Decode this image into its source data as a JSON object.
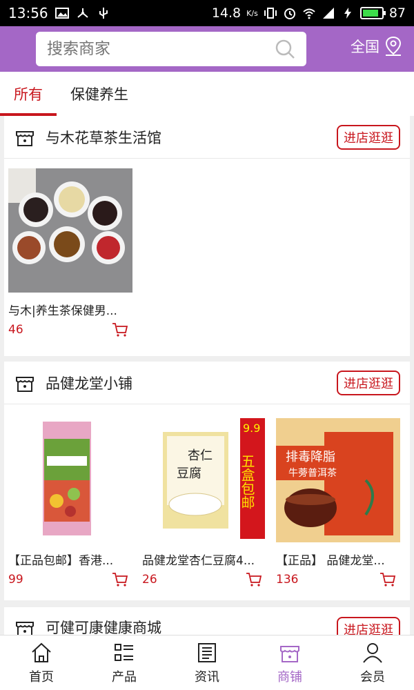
{
  "status": {
    "time": "13:56",
    "speed": "14.8",
    "speed_unit": "K/s",
    "battery": "87",
    "battery_fill": 0.87
  },
  "header": {
    "search_placeholder": "搜索商家",
    "region": "全国"
  },
  "tabs": [
    {
      "label": "所有",
      "active": true
    },
    {
      "label": "保健养生",
      "active": false
    }
  ],
  "shops": [
    {
      "name": "与木花草茶生活馆",
      "visit_label": "进店逛逛",
      "products": [
        {
          "name": "与木|养生茶保健男...",
          "price": "46"
        }
      ]
    },
    {
      "name": "品健龙堂小铺",
      "visit_label": "进店逛逛",
      "products": [
        {
          "name": "【正品包邮】香港...",
          "price": "99"
        },
        {
          "name": "品健龙堂杏仁豆腐4...",
          "price": "26"
        },
        {
          "name": "【正品】 品健龙堂...",
          "price": "136"
        }
      ]
    },
    {
      "name": "可健可康健康商城",
      "visit_label": "进店逛逛",
      "products": []
    }
  ],
  "product_art": {
    "almond_tofu": {
      "top": "杏仁",
      "bottom": "豆腐",
      "badge": "9.9",
      "promo": "五盒包邮"
    },
    "puer_tea": {
      "title": "排毒降脂",
      "subtitle": "牛蒡普洱茶"
    }
  },
  "colors": {
    "brand": "#a467c6",
    "accent": "#c8161d"
  },
  "bottom_nav": [
    {
      "label": "首页",
      "icon": "home-icon"
    },
    {
      "label": "产品",
      "icon": "grid-list-icon"
    },
    {
      "label": "资讯",
      "icon": "news-icon"
    },
    {
      "label": "商铺",
      "icon": "store-icon",
      "active": true
    },
    {
      "label": "会员",
      "icon": "user-icon"
    }
  ]
}
